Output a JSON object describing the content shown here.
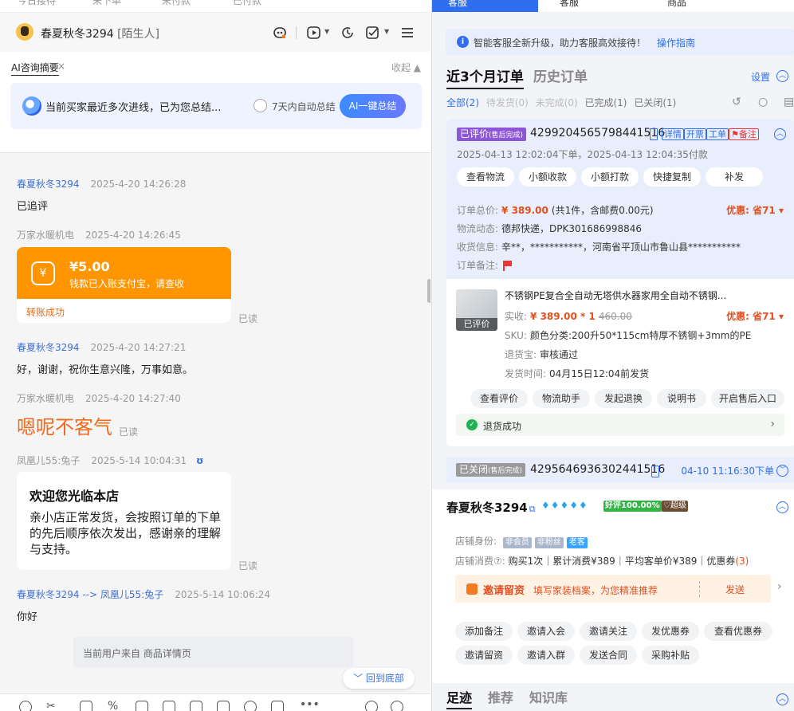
{
  "left": {
    "top_strip": [
      "今日接待",
      "未下单",
      "未付款",
      "已付款"
    ],
    "header": {
      "name": "春夏秋冬3294",
      "tag": "[陌生人]"
    },
    "ai_summary": {
      "title": "AI咨询摘要",
      "close": "×",
      "collapse": "收起 ▲",
      "text": "当前买家最近多次进线，已为您总结...",
      "auto_label": "7天内自动总结",
      "button": "AI一键总结"
    },
    "messages": [
      {
        "sender": "春夏秋冬3294",
        "time": "2025-4-20 14:26:28",
        "text": "已追评"
      },
      {
        "sender": "万家水暖机电",
        "time": "2025-4-20 14:26:45"
      },
      {
        "sender": "春夏秋冬3294",
        "time": "2025-4-20 14:27:21",
        "text": "好，谢谢，祝你生意兴隆，万事如意。"
      },
      {
        "sender": "万家水暖机电",
        "time": "2025-4-20 14:27:40",
        "text": "嗯呢不客气"
      },
      {
        "sender": "凤凰儿55:兔子",
        "time": "2025-5-14 10:04:31",
        "badge": "ʊ"
      },
      {
        "sender": "春夏秋冬3294 --> 凤凰儿55:兔子",
        "time": "2025-5-14 10:06:24",
        "text": "你好"
      }
    ],
    "payment": {
      "icon": "¥",
      "amount": "¥5.00",
      "desc": "钱款已入账支付宝，请查收",
      "status": "转账成功"
    },
    "welcome": {
      "title": "欢迎您光临本店",
      "body": "亲小店正常发货，会按照订单的下单的先后顺序依次发出，感谢亲的理解与支持。"
    },
    "read": "已读",
    "source": "当前用户来自 商品详情页",
    "back_bottom": "﹀ 回到底部"
  },
  "right": {
    "tabs": [
      "客服",
      "客服",
      "商品"
    ],
    "notice": {
      "text": "智能客服全新升级，助力客服高效接待！",
      "link": "操作指南"
    },
    "order_tabs": [
      "近3个月订单",
      "历史订单"
    ],
    "settings": "设置",
    "filters": [
      {
        "label": "全部(2)",
        "state": "active"
      },
      {
        "label": "待发货(0)",
        "state": "dim"
      },
      {
        "label": "未完成(0)",
        "state": "dim"
      },
      {
        "label": "已完成(1)",
        "state": "normal"
      },
      {
        "label": "已关闭(1)",
        "state": "normal"
      }
    ],
    "order1": {
      "status": "已评价",
      "status_sub": "(售后完成)",
      "number": "4299204565798441516",
      "tags": [
        "详情",
        "开票",
        "工单",
        "备注"
      ],
      "dates": "2025-04-13 12:02:04下单，2025-04-13 12:04:35付款",
      "actions": [
        "查看物流",
        "小额收款",
        "小额打款",
        "快捷复制",
        "补发"
      ],
      "total_label": "订单总价:",
      "total_price": "¥ 389.00",
      "total_rest": "(共1件，含邮费0.00元)",
      "discount": "优惠: 省71 ▾",
      "logistics_label": "物流动态:",
      "logistics": "德邦快递，DPK301686998846",
      "address_label": "收货信息:",
      "address": "辛**，***********，河南省平顶山市鲁山县***********",
      "remark_label": "订单备注:",
      "product": {
        "thumb_label": "已评价",
        "title": "不锈钢PE复合全自动无塔供水器家用全自动不锈钢...",
        "paid_label": "实收:",
        "paid": "¥ 389.00 * 1",
        "original": "460.00",
        "discount": "优惠: 省71 ▾",
        "sku_label": "SKU:",
        "sku": "颜色分类:200升50*115cm特厚不锈钢+3mm的PE",
        "refund_label": "退货宝:",
        "refund": "审核通过",
        "ship_label": "发货时间:",
        "ship": "04月15日12:04前发货"
      },
      "product_actions": [
        "查看评价",
        "物流助手",
        "发起退换",
        "说明书",
        "开启售后入口"
      ],
      "refund_status": "退货成功"
    },
    "order2": {
      "status": "已关闭",
      "status_sub": "(售后完成)",
      "number": "4295646936302441516",
      "time": "04-10 11:16:30下单"
    },
    "customer": {
      "name": "春夏秋冬3294",
      "diamonds": "♦♦♦♦♦",
      "rating": "好评100.00%",
      "level": "♡超级",
      "identity_label": "店铺身份:",
      "identity_tags": [
        "非会员",
        "非粉丝",
        "老客"
      ],
      "spend_label": "店铺消费⑦:",
      "spend": "购买1次｜累计消费¥389｜平均客单价¥389｜优惠券",
      "coupon_count": "(3)",
      "invite": {
        "title": "邀请留资",
        "desc": "填写家装档案，为您精准推荐",
        "send": "发送"
      },
      "actions_row1": [
        "添加备注",
        "邀请入会",
        "邀请关注",
        "发优惠券",
        "查看优惠券"
      ],
      "actions_row2": [
        "邀请留资",
        "邀请入群",
        "发送合同",
        "采购补贴"
      ]
    },
    "bottom_tabs": [
      "足迹",
      "推荐",
      "知识库"
    ]
  }
}
